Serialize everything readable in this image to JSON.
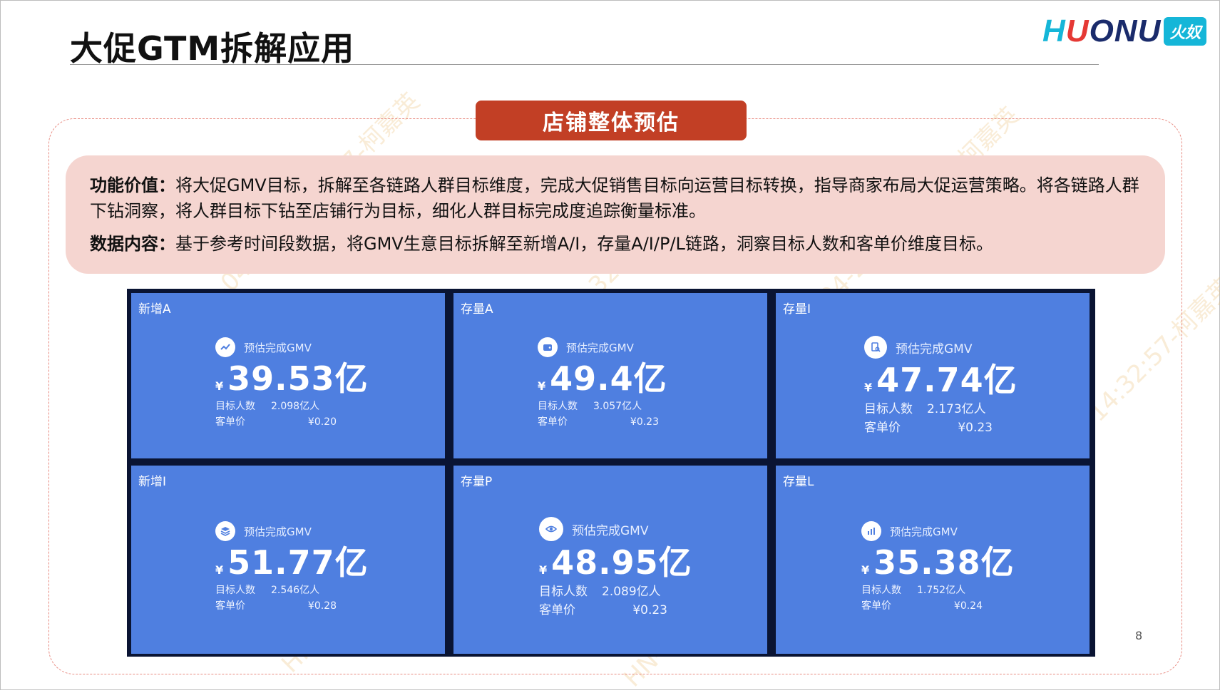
{
  "title": "大促GTM拆解应用",
  "logo": {
    "h": "H",
    "u": "U",
    "rest": "ONU",
    "badge": "火奴"
  },
  "section_title": "店铺整体预估",
  "info": {
    "line1_label": "功能价值：",
    "line1_text": "将大促GMV目标，拆解至各链路人群目标维度，完成大促销售目标向运营目标转换，指导商家布局大促运营策略。将各链路人群下钻洞察，将人群目标下钻至店铺行为目标，细化人群目标完成度追踪衡量标准。",
    "line2_label": "数据内容：",
    "line2_text": "基于参考时间段数据，将GMV生意目标拆解至新增A/I，存量A/I/P/L链路，洞察目标人数和客单价维度目标。"
  },
  "cards": [
    {
      "name": "新增A",
      "gmv_label": "预估完成GMV",
      "yen": "¥",
      "gmv": "39.53亿",
      "people_label": "目标人数",
      "people": "2.098亿人",
      "price_label": "客单价",
      "price": "¥0.20",
      "icon": "trend-icon"
    },
    {
      "name": "存量A",
      "gmv_label": "预估完成GMV",
      "yen": "¥",
      "gmv": "49.4亿",
      "people_label": "目标人数",
      "people": "3.057亿人",
      "price_label": "客单价",
      "price": "¥0.23",
      "icon": "wallet-icon"
    },
    {
      "name": "存量I",
      "gmv_label": "预估完成GMV",
      "yen": "¥",
      "gmv": "47.74亿",
      "people_label": "目标人数",
      "people": "2.173亿人",
      "price_label": "客单价",
      "price": "¥0.23",
      "icon": "search-doc-icon"
    },
    {
      "name": "新增I",
      "gmv_label": "预估完成GMV",
      "yen": "¥",
      "gmv": "51.77亿",
      "people_label": "目标人数",
      "people": "2.546亿人",
      "price_label": "客单价",
      "price": "¥0.28",
      "icon": "layers-icon"
    },
    {
      "name": "存量P",
      "gmv_label": "预估完成GMV",
      "yen": "¥",
      "gmv": "48.95亿",
      "people_label": "目标人数",
      "people": "2.089亿人",
      "price_label": "客单价",
      "price": "¥0.23",
      "icon": "eye-icon"
    },
    {
      "name": "存量L",
      "gmv_label": "预估完成GMV",
      "yen": "¥",
      "gmv": "35.38亿",
      "people_label": "目标人数",
      "people": "1.752亿人",
      "price_label": "客单价",
      "price": "¥0.24",
      "icon": "bar-chart-icon"
    }
  ],
  "page_number": "8",
  "watermark": "HN-2022-04-21 14:32:57-柯嘉英",
  "colors": {
    "accent": "#c23f25",
    "card": "#4f7fe0",
    "grid_bg": "#0a1433",
    "info_bg": "#f5d5d0"
  }
}
